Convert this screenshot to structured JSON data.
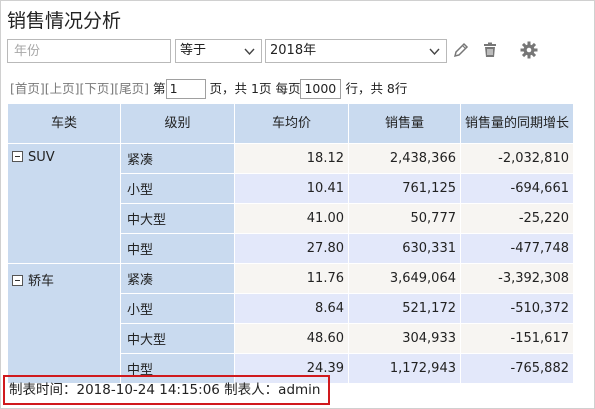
{
  "title": "销售情况分析",
  "filter": {
    "field_placeholder": "年份",
    "operator": "等于",
    "value": "2018年"
  },
  "toolbar": {
    "edit_icon": "pencil-icon",
    "delete_icon": "trash-icon",
    "settings_icon": "gear-icon"
  },
  "pager": {
    "first": "[首页]",
    "prev": "[上页]",
    "next": "[下页]",
    "last": "[尾页]",
    "page_prefix": "第",
    "page_value": "1",
    "page_suffix": "页，共 1页 每页",
    "page_size": "1000",
    "rows_suffix": "行，共 8行"
  },
  "table": {
    "headers": [
      "车类",
      "级别",
      "车均价",
      "销售量",
      "销售量的同期增长"
    ],
    "groups": [
      {
        "name": "SUV",
        "rows": [
          {
            "level": "紧凑",
            "price": "18.12",
            "sales": "2,438,366",
            "growth": "-2,032,810"
          },
          {
            "level": "小型",
            "price": "10.41",
            "sales": "761,125",
            "growth": "-694,661"
          },
          {
            "level": "中大型",
            "price": "41.00",
            "sales": "50,777",
            "growth": "-25,220"
          },
          {
            "level": "中型",
            "price": "27.80",
            "sales": "630,331",
            "growth": "-477,748"
          }
        ]
      },
      {
        "name": "轿车",
        "rows": [
          {
            "level": "紧凑",
            "price": "11.76",
            "sales": "3,649,064",
            "growth": "-3,392,308"
          },
          {
            "level": "小型",
            "price": "8.64",
            "sales": "521,172",
            "growth": "-510,372"
          },
          {
            "level": "中大型",
            "price": "48.60",
            "sales": "304,933",
            "growth": "-151,617"
          },
          {
            "level": "中型",
            "price": "24.39",
            "sales": "1,172,943",
            "growth": "-765,882"
          }
        ]
      }
    ]
  },
  "footer": {
    "text": "制表时间：2018-10-24 14:15:06   制表人：admin"
  }
}
